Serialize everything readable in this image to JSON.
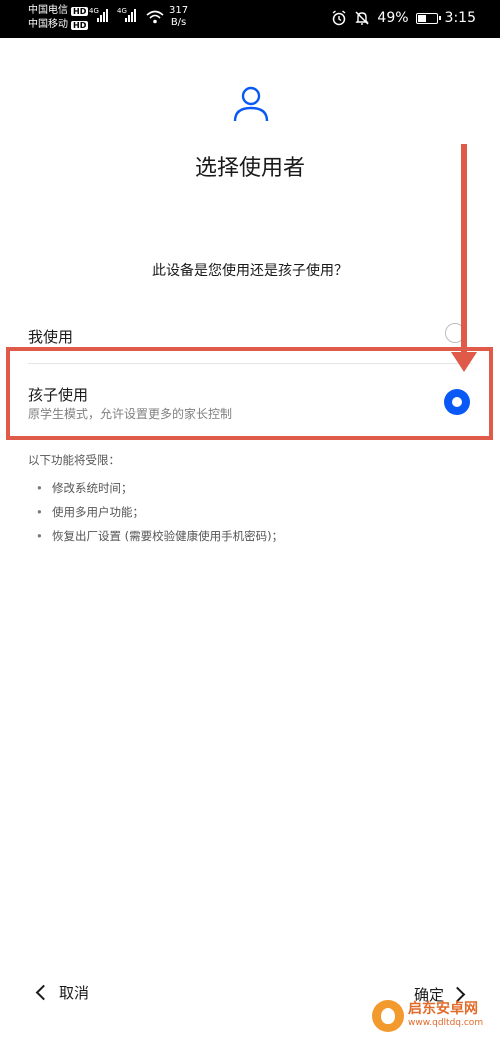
{
  "status_bar": {
    "carrier1": "中国电信",
    "carrier2": "中国移动",
    "hd_badge": "HD",
    "net_type": "4G",
    "net_speed": "317",
    "net_unit": "B/s",
    "battery_pct": "49%",
    "battery_level": 0.49,
    "time": "3:15"
  },
  "header": {
    "icon": "user-icon",
    "title": "选择使用者"
  },
  "question": "此设备是您使用还是孩子使用？",
  "options": [
    {
      "label": "我使用",
      "selected": false
    },
    {
      "label": "孩子使用",
      "subtitle": "原学生模式，允许设置更多的家长控制",
      "selected": true
    }
  ],
  "restrictions": {
    "title": "以下功能将受限：",
    "items": [
      "修改系统时间；",
      "使用多用户功能；",
      "恢复出厂设置 (需要校验健康使用手机密码)；"
    ]
  },
  "footer": {
    "cancel_label": "取消",
    "confirm_label": "确定"
  },
  "watermark": {
    "name": "启东安卓网",
    "url": "www.qdltdq.com"
  },
  "colors": {
    "accent": "#0a59f7",
    "annotation": "#e05a4a"
  }
}
